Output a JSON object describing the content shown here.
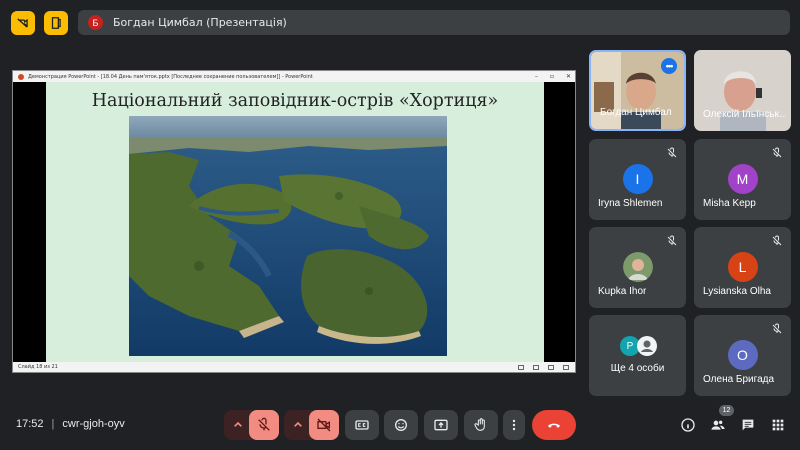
{
  "top_bar": {
    "presenter_initial": "Б",
    "presenter_label": "Богдан Цимбал (Презентація)",
    "accent": "#fbbc04"
  },
  "presentation": {
    "window_title": "Демонстрация PowerPoint - [18.04 День пам'яток.pptx [Последнее сохранение пользователем]] - PowerPoint",
    "slide_title": "Національний заповідник-острів «Хортиця»",
    "status_text": "Слайд 18 из 21"
  },
  "participants": [
    {
      "name": "Богдан Цимбал",
      "type": "video"
    },
    {
      "name": "Олексій Ільїнськ…",
      "type": "video"
    },
    {
      "name": "Iryna Shlemen",
      "initial": "I",
      "color": "#1a73e8",
      "muted": true
    },
    {
      "name": "Misha Kepp",
      "initial": "M",
      "color": "#a142c8",
      "muted": true
    },
    {
      "name": "Kupka Ihor",
      "initial": "",
      "color": "#4a6b4a",
      "muted": true
    },
    {
      "name": "Lysianska Olha",
      "initial": "L",
      "color": "#d84315",
      "muted": true
    },
    {
      "name": "Ще 4 особи",
      "initial": "P",
      "color": "#12a4af",
      "muted": false
    },
    {
      "name": "Олена Бригада",
      "initial": "O",
      "color": "#5c6bc0",
      "muted": true
    }
  ],
  "bottom_bar": {
    "time": "17:52",
    "separator": "|",
    "meeting_code": "cwr-gjoh-oyv",
    "participant_count": "12",
    "end_color": "#ea4335"
  }
}
